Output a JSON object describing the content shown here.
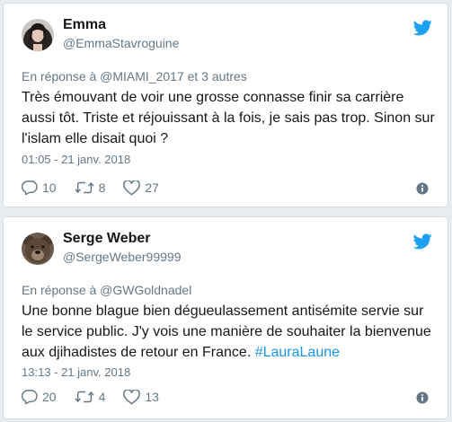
{
  "tweets": [
    {
      "name": "Emma",
      "handle": "@EmmaStavroguine",
      "reply_prefix": "En réponse à ",
      "reply_to": "@MIAMI_2017 et 3 autres",
      "text": "Très émouvant de voir une grosse connasse finir sa carrière aussi tôt. Triste et réjouissant à la fois, je sais pas trop. Sinon sur l'islam elle disait quoi ?",
      "hashtag": "",
      "timestamp": "01:05 - 21 janv. 2018",
      "replies": "10",
      "retweets": "8",
      "likes": "27",
      "avatar_icon": "woman-portrait"
    },
    {
      "name": "Serge Weber",
      "handle": "@SergeWeber99999",
      "reply_prefix": "En réponse à ",
      "reply_to": "@GWGoldnadel",
      "text": "Une bonne blague bien dégueulassement antisémite servie sur le service public. J'y vois une manière de souhaiter la bienvenue aux djihadistes de retour en France. ",
      "hashtag": "#LauraLaune",
      "timestamp": "13:13 - 21 janv. 2018",
      "replies": "20",
      "retweets": "4",
      "likes": "13",
      "avatar_icon": "bear-portrait"
    }
  ],
  "colors": {
    "background": "#e6ecf0",
    "card": "#ffffff",
    "twitter_blue": "#1da1f2",
    "link": "#1b95e0",
    "muted": "#657786"
  },
  "icons": [
    "twitter-bird-icon",
    "reply-icon",
    "retweet-icon",
    "like-icon",
    "info-icon"
  ]
}
